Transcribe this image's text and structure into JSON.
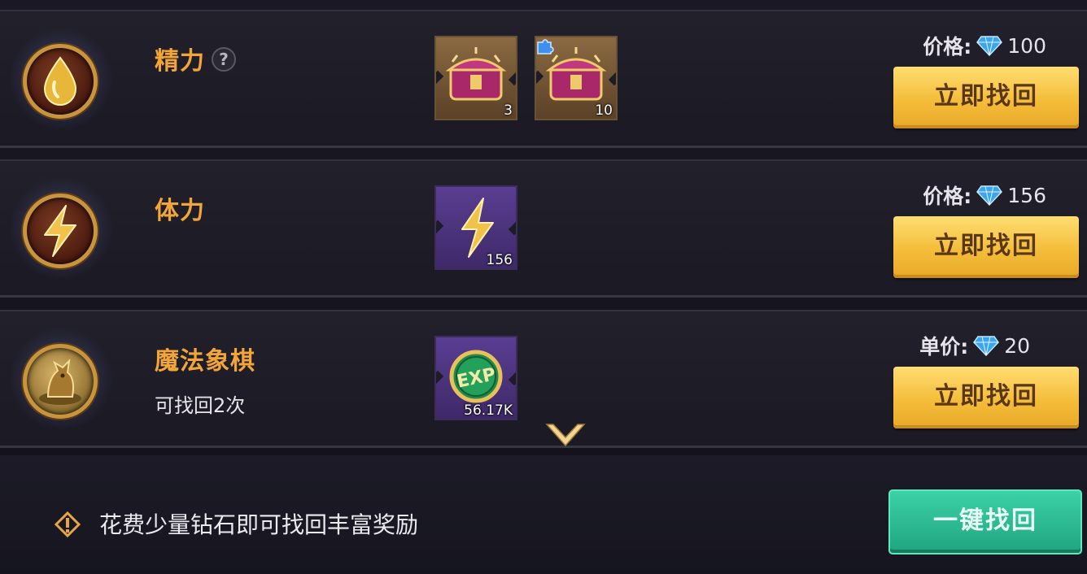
{
  "rows": [
    {
      "title": "精力",
      "has_help": true,
      "help_label": "?",
      "subtitle": "",
      "price_label": "价格:",
      "price_value": "100",
      "button_label": "立即找回",
      "icon": "energy-drop-icon",
      "items": [
        {
          "icon": "treasure-chest-icon",
          "qty": "3"
        },
        {
          "icon": "treasure-chest-icon",
          "qty": "10",
          "badge": "puzzle-piece-icon"
        }
      ]
    },
    {
      "title": "体力",
      "subtitle": "",
      "price_label": "价格:",
      "price_value": "156",
      "button_label": "立即找回",
      "icon": "lightning-icon",
      "items": [
        {
          "icon": "lightning-icon",
          "qty": "156"
        }
      ]
    },
    {
      "title": "魔法象棋",
      "subtitle": "可找回2次",
      "price_label": "单价:",
      "price_value": "20",
      "button_label": "立即找回",
      "icon": "dragon-chess-icon",
      "items": [
        {
          "icon": "exp-coin-icon",
          "qty": "56.17K",
          "label": "EXP"
        }
      ]
    }
  ],
  "footer": {
    "tip": "花费少量钻石即可找回丰富奖励",
    "all_button": "一键找回"
  },
  "colors": {
    "title": "#f2a637",
    "gold_button": "#f4bd3a",
    "green_button": "#2fbf94",
    "diamond": "#3aa6f0"
  }
}
